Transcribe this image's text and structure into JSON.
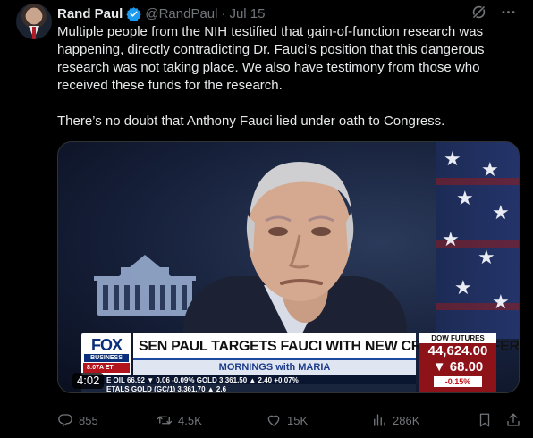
{
  "post": {
    "author_name": "Rand Paul",
    "handle": "@RandPaul",
    "separator": "·",
    "date": "Jul 15",
    "paragraph_1": "Multiple people from the NIH testified that gain-of-function research was happening, directly contradicting Dr. Fauci’s position that this dangerous research was not taking place. We also have testimony from those who received these funds for the research.",
    "paragraph_2": "There’s no doubt that Anthony Fauci lied under oath to Congress."
  },
  "video": {
    "duration": "4:02",
    "network_top": "FOX",
    "network_bottom": "BUSINESS",
    "clock": "8:07A ET",
    "headline": "SEN PAUL TARGETS FAUCI WITH NEW CRIMINAL REFERRAL",
    "show_name": "MORNINGS with MARIA",
    "dow_label": "DOW FUTURES",
    "dow_value": "44,624.00",
    "dow_change": "68.00",
    "dow_percent": "-0.15%",
    "ticker_1": "E OIL      66.92  ▼ 0.06  -0.09%   GOLD            3,361.50  ▲ 2.40  +0.07%",
    "ticker_2": "ETALS                               GOLD (GC/1)   3,361.70  ▲ 2.6"
  },
  "actions": {
    "replies": "855",
    "reposts": "4.5K",
    "likes": "15K",
    "views": "286K"
  },
  "colors": {
    "background": "#000000",
    "text": "#e7e9ea",
    "muted": "#71767b",
    "verified": "#1d9bf0"
  },
  "icons": [
    "verified-badge-icon",
    "grok-icon",
    "more-icon",
    "reply-icon",
    "repost-icon",
    "like-icon",
    "views-icon",
    "bookmark-icon",
    "share-icon"
  ]
}
